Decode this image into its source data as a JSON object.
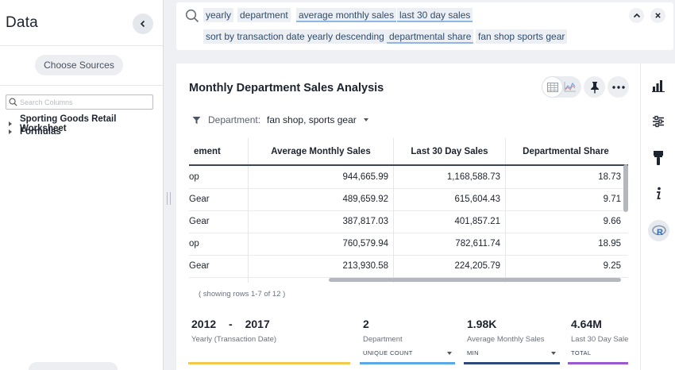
{
  "data_panel": {
    "title": "Data",
    "choose_sources_label": "Choose Sources",
    "search_placeholder": "Search Columns",
    "tree": [
      "Sporting Goods Retail Worksheet",
      "Formulas"
    ]
  },
  "search": {
    "tokens": [
      "yearly",
      "department",
      "average monthly sales",
      "last 30 day sales",
      "sort by transaction date yearly descending",
      "departmental share",
      "fan shop sports gear"
    ]
  },
  "card": {
    "title": "Monthly Department Sales Analysis",
    "filter": {
      "label": "Department:",
      "value": "fan shop, sports gear"
    }
  },
  "table": {
    "columns": [
      "ement",
      "Average Monthly Sales",
      "Last 30 Day Sales",
      "Departmental Share"
    ],
    "rows": [
      [
        "op",
        "944,665.99",
        "1,168,588.73",
        "18.73"
      ],
      [
        " Gear",
        "489,659.92",
        "615,604.43",
        "9.71"
      ],
      [
        " Gear",
        "387,817.03",
        "401,857.21",
        "9.66"
      ],
      [
        "op",
        "760,579.94",
        "782,611.74",
        "18.95"
      ],
      [
        " Gear",
        "213,930.58",
        "224,205.79",
        "9.25"
      ]
    ],
    "showing": "( showing rows 1-7 of 12 )"
  },
  "stats": [
    {
      "value_from": "2012",
      "sep": "-",
      "value_to": "2017",
      "label": "Yearly (Transaction Date)",
      "color": "#f2c94c"
    },
    {
      "value": "2",
      "label": "Department",
      "agg": "UNIQUE COUNT",
      "color": "#5aa9e6"
    },
    {
      "value": "1.98K",
      "label": "Average Monthly Sales",
      "agg": "MIN",
      "color": "#2d4a7a"
    },
    {
      "value": "4.64M",
      "label": "Last 30 Day Sale",
      "agg": "TOTAL",
      "color": "#9b59d0"
    }
  ],
  "right_rail": {
    "icons": [
      "bar-chart-icon",
      "sliders-icon",
      "brush-icon",
      "info-icon",
      "r-icon"
    ],
    "r_label": "R"
  },
  "colors": {
    "token_underline": "#8fb7e3",
    "accent": "#2d4a7a"
  }
}
